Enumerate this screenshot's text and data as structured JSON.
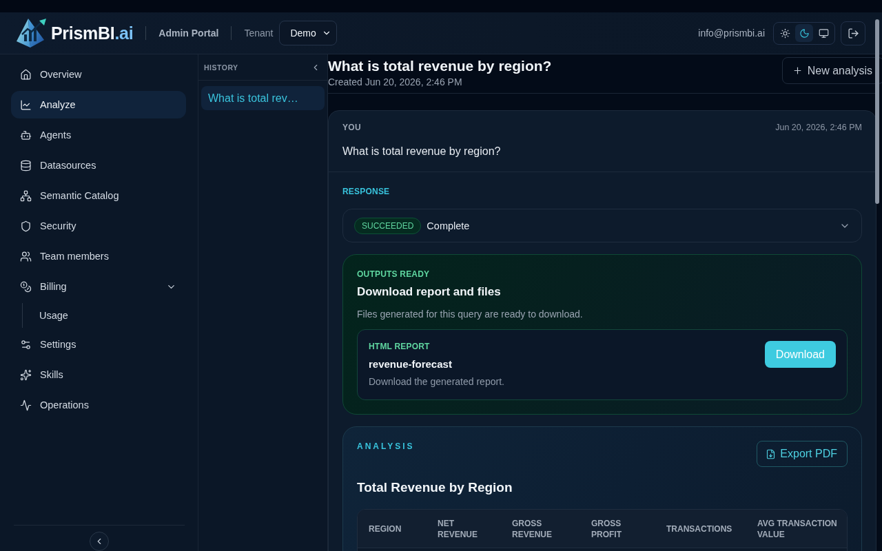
{
  "header": {
    "logo": {
      "name": "PrismBI",
      "suffix": ".ai"
    },
    "portal": "Admin Portal",
    "tenant": {
      "label": "Tenant",
      "value": "Demo"
    },
    "user_email": "info@prismbi.ai",
    "theme_options": [
      {
        "kind": "light",
        "selected": false
      },
      {
        "kind": "dark",
        "selected": true
      },
      {
        "kind": "system",
        "selected": false
      }
    ]
  },
  "sidebar": {
    "items": [
      {
        "label": "Overview",
        "selected": false
      },
      {
        "label": "Analyze",
        "selected": true
      },
      {
        "label": "Agents",
        "selected": false
      },
      {
        "label": "Datasources",
        "selected": false
      },
      {
        "label": "Semantic Catalog",
        "selected": false
      },
      {
        "label": "Security",
        "selected": false
      },
      {
        "label": "Team members",
        "selected": false
      },
      {
        "label": "Billing",
        "selected": false,
        "expanded": true,
        "children": [
          {
            "label": "Usage",
            "selected": false
          }
        ]
      },
      {
        "label": "Settings",
        "selected": false
      },
      {
        "label": "Skills",
        "selected": false
      },
      {
        "label": "Operations",
        "selected": false
      }
    ]
  },
  "history": {
    "title": "HISTORY",
    "items": [
      {
        "label": "What is total rev…",
        "selected": true
      }
    ]
  },
  "main": {
    "title": "What is total revenue by region?",
    "created": "Created Jun 20, 2026, 2:46 PM",
    "new_button": "New analysis",
    "message": {
      "author": "YOU",
      "time": "Jun 20, 2026, 2:46 PM",
      "text": "What is total revenue by region?"
    },
    "response": {
      "label": "RESPONSE",
      "status": {
        "badge": "SUCCEEDED",
        "text": "Complete",
        "expanded": false
      }
    },
    "outputs": {
      "label": "OUTPUTS READY",
      "title": "Download report and files",
      "description": "Files generated for this query are ready to download.",
      "files": [
        {
          "type": "HTML REPORT",
          "name": "revenue-forecast",
          "description": "Download the generated report.",
          "button": "Download"
        }
      ]
    },
    "analysis": {
      "label": "ANALYSIS",
      "export_button": "Export PDF",
      "title": "Total Revenue by Region",
      "table": {
        "columns": [
          "REGION",
          "NET REVENUE",
          "GROSS REVENUE",
          "GROSS PROFIT",
          "TRANSACTIONS",
          "AVG TRANSACTION VALUE"
        ]
      }
    }
  }
}
